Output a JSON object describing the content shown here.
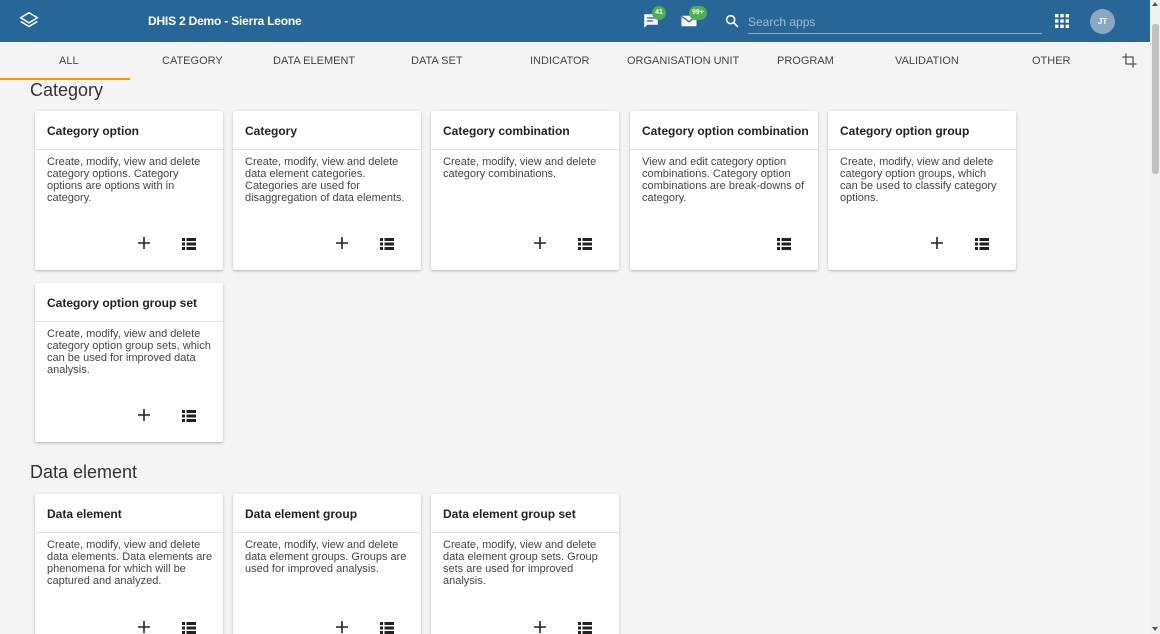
{
  "header": {
    "title": "DHIS 2 Demo - Sierra Leone",
    "messages_count": "41",
    "interpretations_count": "99+",
    "search_placeholder": "Search apps",
    "user_initials": "JT",
    "bar_color": "#276696"
  },
  "tabs": [
    {
      "label": "ALL",
      "active": true
    },
    {
      "label": "CATEGORY"
    },
    {
      "label": "DATA ELEMENT"
    },
    {
      "label": "DATA SET"
    },
    {
      "label": "INDICATOR"
    },
    {
      "label": "ORGANISATION UNIT"
    },
    {
      "label": "PROGRAM"
    },
    {
      "label": "VALIDATION"
    },
    {
      "label": "OTHER"
    }
  ],
  "accent_color": "#ff9800",
  "sections": [
    {
      "title": "Category",
      "cards": [
        {
          "title": "Category option",
          "description": "Create, modify, view and delete category options. Category options are options with in category.",
          "can_add": true
        },
        {
          "title": "Category",
          "description": "Create, modify, view and delete data element categories. Categories are used for disaggregation of data elements.",
          "can_add": true
        },
        {
          "title": "Category combination",
          "description": "Create, modify, view and delete category combinations.",
          "can_add": true
        },
        {
          "title": "Category option combination",
          "description": "View and edit category option combinations. Category option combinations are break-downs of category.",
          "can_add": false
        },
        {
          "title": "Category option group",
          "description": "Create, modify, view and delete category option groups, which can be used to classify category options.",
          "can_add": true
        },
        {
          "title": "Category option group set",
          "description": "Create, modify, view and delete category option group sets, which can be used for improved data analysis.",
          "can_add": true
        }
      ]
    },
    {
      "title": "Data element",
      "cards": [
        {
          "title": "Data element",
          "description": "Create, modify, view and delete data elements. Data elements are phenomena for which will be captured and analyzed.",
          "can_add": true
        },
        {
          "title": "Data element group",
          "description": "Create, modify, view and delete data element groups. Groups are used for improved analysis.",
          "can_add": true
        },
        {
          "title": "Data element group set",
          "description": "Create, modify, view and delete data element group sets. Group sets are used for improved analysis.",
          "can_add": true
        }
      ]
    }
  ]
}
